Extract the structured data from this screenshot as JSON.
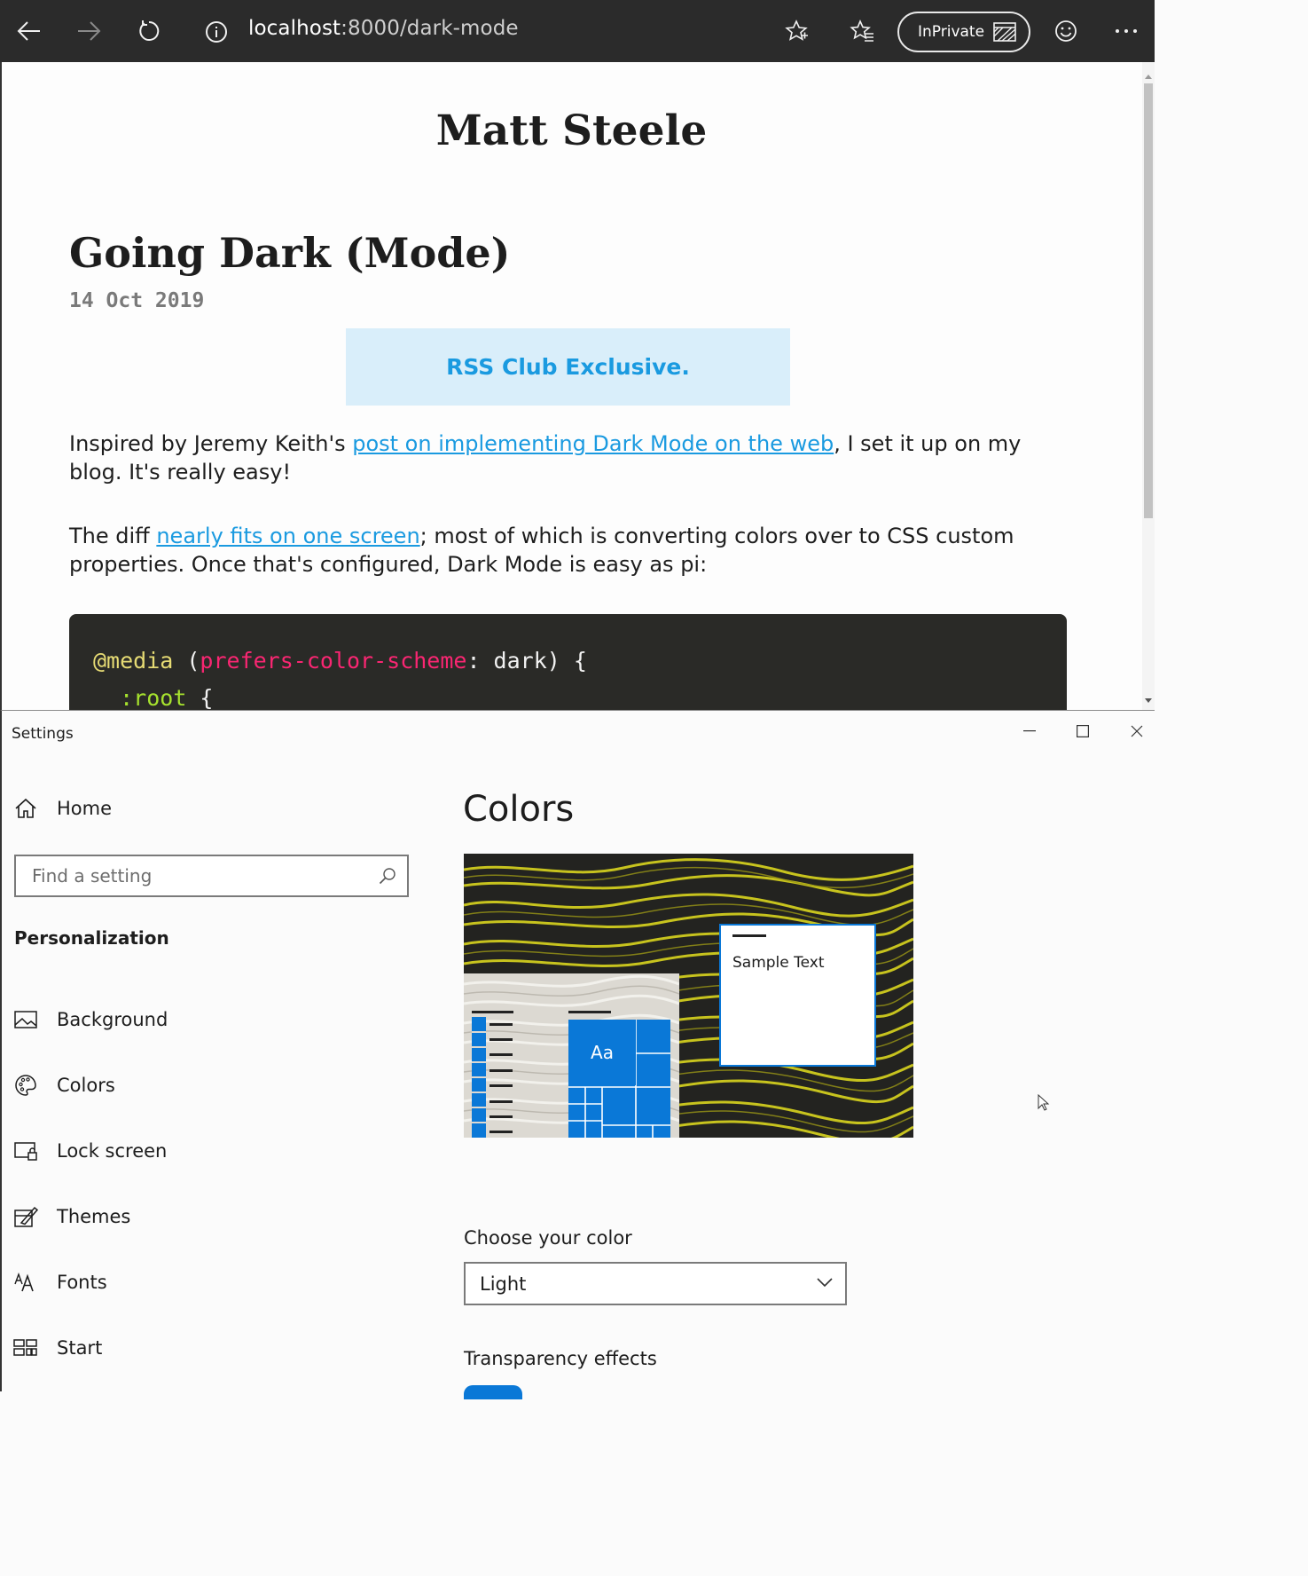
{
  "browser": {
    "url_host": "localhost",
    "url_path": ":8000/dark-mode",
    "inprivate_label": "InPrivate",
    "icons": [
      "back-arrow-icon",
      "forward-arrow-icon",
      "refresh-icon",
      "info-icon",
      "favorite-star-icon",
      "favorites-list-icon",
      "inprivate-icon",
      "smiley-icon",
      "more-icon"
    ]
  },
  "webpage": {
    "site_title": "Matt Steele",
    "post_title": "Going Dark (Mode)",
    "post_date": "14 Oct 2019",
    "rss_banner": "RSS Club Exclusive.",
    "paragraph1": {
      "before": "Inspired by Jeremy Keith's ",
      "link": "post on implementing Dark Mode on the web",
      "after": ", I set it up on my blog. It's really easy!"
    },
    "paragraph2": {
      "before": "The diff ",
      "link": "nearly fits on one screen",
      "after": "; most of which is converting colors over to CSS custom properties. Once that's configured, Dark Mode is easy as pi:"
    },
    "code": {
      "line1_kw": "@media",
      "line1_open": " (",
      "line1_prop": "prefers-color-scheme",
      "line1_rest": ": dark) {",
      "line2_indent": "  ",
      "line2_sel": ":root",
      "line2_rest": " {"
    },
    "colors": {
      "link": "#1a9ae0",
      "rss_bg": "#d9eefa",
      "code_bg": "#2a2a27"
    }
  },
  "settings": {
    "window_title": "Settings",
    "nav_home": "Home",
    "search_placeholder": "Find a setting",
    "section": "Personalization",
    "nav_items": [
      {
        "label": "Background",
        "icon": "picture-icon"
      },
      {
        "label": "Colors",
        "icon": "palette-icon"
      },
      {
        "label": "Lock screen",
        "icon": "lock-screen-icon"
      },
      {
        "label": "Themes",
        "icon": "themes-icon"
      },
      {
        "label": "Fonts",
        "icon": "fonts-icon"
      },
      {
        "label": "Start",
        "icon": "start-icon"
      }
    ],
    "page_title": "Colors",
    "preview": {
      "sample_text": "Sample Text",
      "tile_text": "Aa"
    },
    "choose_color_label": "Choose your color",
    "choose_color_value": "Light",
    "transparency_label": "Transparency effects",
    "accent_color": "#0a78d7"
  }
}
